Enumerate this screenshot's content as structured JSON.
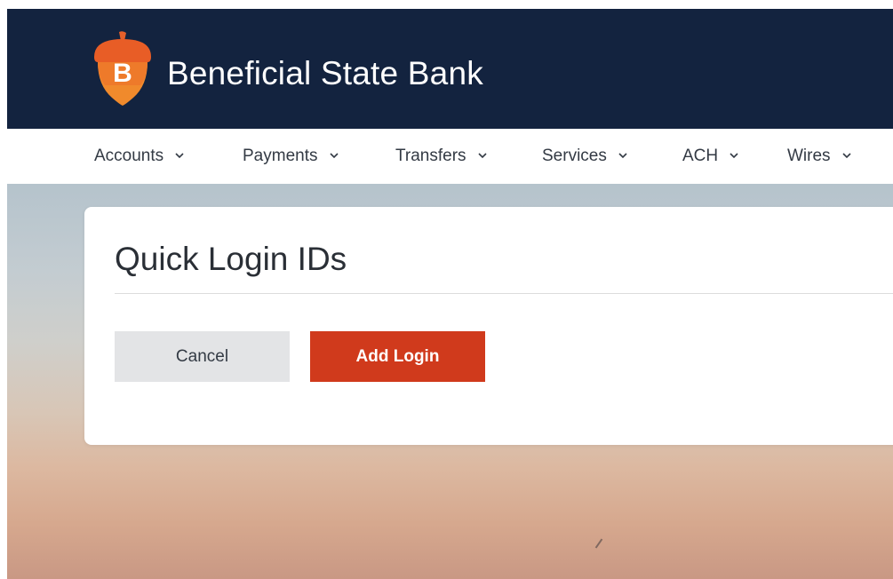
{
  "header": {
    "bank_name": "Beneficial State Bank",
    "logo_letter": "B"
  },
  "nav": {
    "items": [
      {
        "label": "Accounts"
      },
      {
        "label": "Payments"
      },
      {
        "label": "Transfers"
      },
      {
        "label": "Services"
      },
      {
        "label": "ACH"
      },
      {
        "label": "Wires"
      }
    ]
  },
  "card": {
    "title": "Quick Login IDs",
    "cancel_label": "Cancel",
    "add_label": "Add Login"
  },
  "colors": {
    "header_bg": "#13233f",
    "accent_orange": "#e86a24",
    "primary_button": "#d03a1c",
    "secondary_button": "#e3e4e6"
  },
  "icons": {
    "nav_dropdown": "chevron-down-icon",
    "logo": "acorn-logo-icon"
  }
}
